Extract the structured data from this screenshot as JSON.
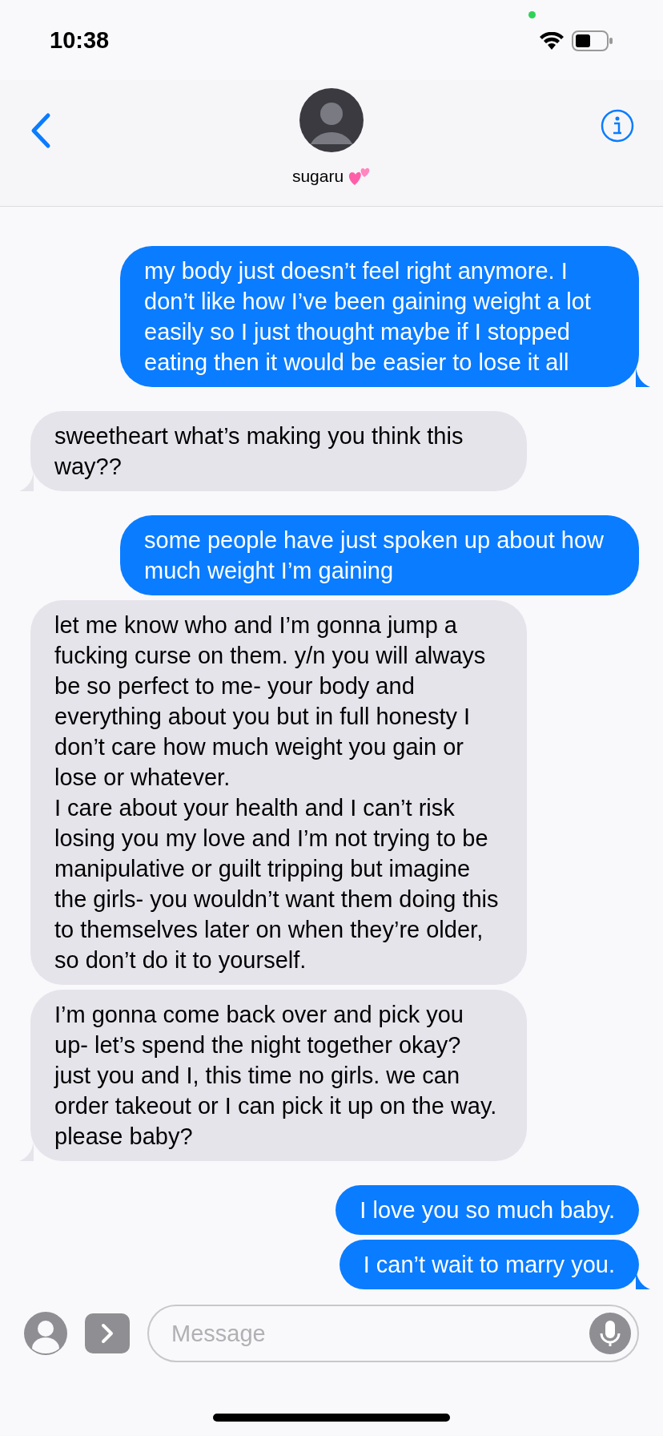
{
  "status_bar": {
    "time": "10:38"
  },
  "contact": {
    "name": "sugaru"
  },
  "messages": [
    {
      "kind": "sent",
      "text": "my body just doesn’t feel right anymore. I don’t like how I’ve been gaining weight a lot easily so I just thought maybe if I stopped eating then it would be easier to lose it all",
      "tail": true
    },
    {
      "kind": "received",
      "text": "sweetheart what’s making you think this way??",
      "tail": true
    },
    {
      "kind": "sent",
      "text": "some people have just spoken up about how much weight I’m gaining",
      "tail": false
    },
    {
      "kind": "received",
      "text": "let me know who and I’m gonna jump a fucking curse on them. y/n you will always be so perfect to me- your body and everything about you but in full honesty I don’t care how much weight you gain or lose or whatever.\nI care about your health and I can’t risk losing you my love and I’m not trying to be manipulative or guilt tripping but imagine the girls- you wouldn’t want them doing this to themselves later on when they’re older, so don’t do it to yourself.",
      "tail": false
    },
    {
      "kind": "received",
      "text": "I’m gonna come back over and pick you up- let’s spend the night together okay? just you and I, this time no girls. we can order takeout or I can pick it up on the way. please baby?",
      "tail": true
    },
    {
      "kind": "sent",
      "text": "I love you so much baby.",
      "tail": false
    },
    {
      "kind": "sent",
      "text": "I can’t wait to marry you.",
      "tail": true
    }
  ],
  "composer": {
    "placeholder": "Message"
  }
}
